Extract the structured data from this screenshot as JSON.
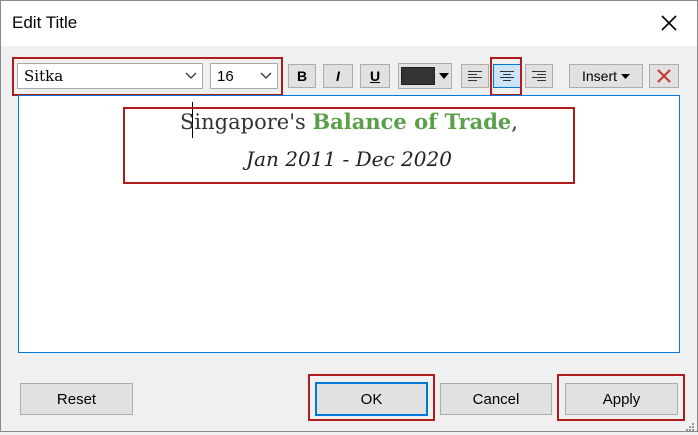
{
  "window": {
    "title": "Edit Title"
  },
  "toolbar": {
    "font_family": "Sitka",
    "font_size": "16",
    "bold_label": "B",
    "italic_label": "I",
    "underline_label": "U",
    "text_color": "#333333",
    "insert_label": "Insert",
    "alignment": "center"
  },
  "editor": {
    "line1_prefix": "Singapore's ",
    "line1_highlight": "Balance of Trade",
    "line1_suffix": ",",
    "line2": "Jan 2011 - Dec 2020",
    "highlight_color": "#5aa04a"
  },
  "footer": {
    "reset_label": "Reset",
    "ok_label": "OK",
    "cancel_label": "Cancel",
    "apply_label": "Apply"
  }
}
